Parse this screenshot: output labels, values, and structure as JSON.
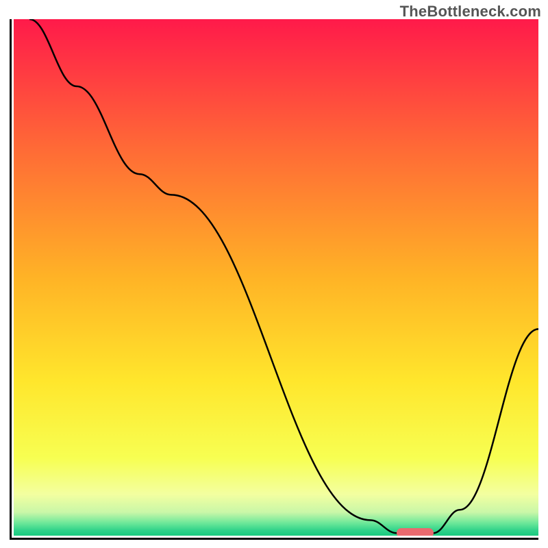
{
  "watermark": "TheBottleneck.com",
  "chart_data": {
    "type": "line",
    "title": "",
    "xlabel": "",
    "ylabel": "",
    "xlim": [
      0,
      100
    ],
    "ylim": [
      0,
      100
    ],
    "grid": false,
    "legend": false,
    "background_gradient_stops": [
      {
        "offset": 0.0,
        "color": "#ff1a4a"
      },
      {
        "offset": 0.25,
        "color": "#ff6a36"
      },
      {
        "offset": 0.5,
        "color": "#ffb326"
      },
      {
        "offset": 0.7,
        "color": "#ffe62c"
      },
      {
        "offset": 0.85,
        "color": "#f7ff52"
      },
      {
        "offset": 0.92,
        "color": "#f3ffa0"
      },
      {
        "offset": 0.955,
        "color": "#c9f7a8"
      },
      {
        "offset": 0.975,
        "color": "#6fe89a"
      },
      {
        "offset": 0.99,
        "color": "#2fd28a"
      },
      {
        "offset": 1.0,
        "color": "#18c97f"
      }
    ],
    "series": [
      {
        "name": "bottleneck-curve",
        "x": [
          3,
          12,
          24,
          30,
          68,
          73,
          80,
          85,
          100
        ],
        "values": [
          100,
          87,
          70,
          66,
          3,
          0.5,
          0.5,
          5,
          40
        ]
      }
    ],
    "highlight_marker": {
      "x_start": 73,
      "x_end": 80,
      "y": 0.5,
      "color": "#e96a6f"
    }
  }
}
